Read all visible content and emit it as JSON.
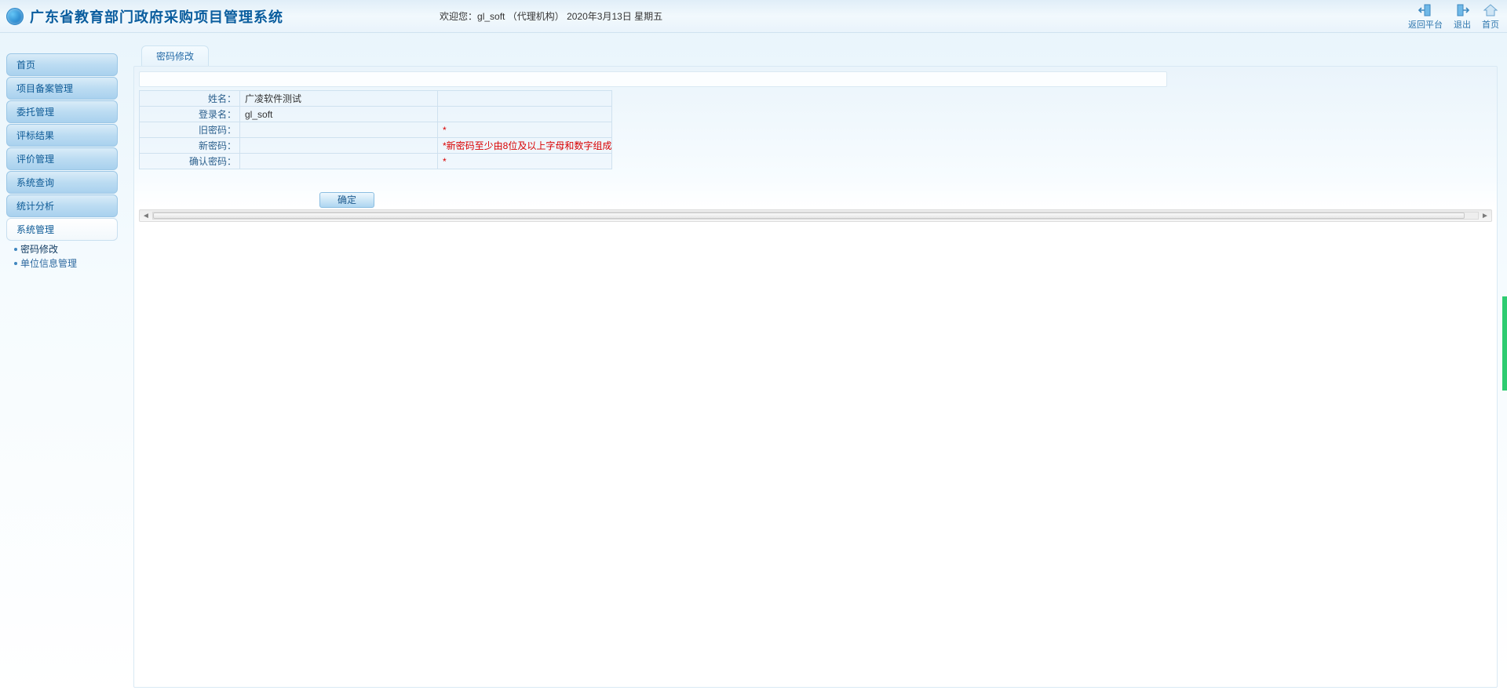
{
  "header": {
    "title": "广东省教育部门政府采购项目管理系统",
    "welcome_prefix": "欢迎您：",
    "user": "gl_soft",
    "role": "（代理机构）",
    "date": "2020年3月13日 星期五",
    "actions": {
      "return": "返回平台",
      "logout": "退出",
      "home": "首页"
    }
  },
  "nav": {
    "items": [
      "首页",
      "项目备案管理",
      "委托管理",
      "评标结果",
      "评价管理",
      "系统查询",
      "统计分析",
      "系统管理"
    ],
    "active_index": 7,
    "sub": [
      "密码修改",
      "单位信息管理"
    ],
    "sub_active_index": 0
  },
  "tab": {
    "label": "密码修改"
  },
  "form": {
    "rows": {
      "name": {
        "label": "姓名：",
        "value": "广凌软件测试",
        "tip": ""
      },
      "login": {
        "label": "登录名：",
        "value": "gl_soft",
        "tip": ""
      },
      "oldpw": {
        "label": "旧密码：",
        "value": "",
        "tip": "*"
      },
      "newpw": {
        "label": "新密码：",
        "value": "",
        "tip": "*新密码至少由8位及以上字母和数字组成"
      },
      "confirm": {
        "label": "确认密码：",
        "value": "",
        "tip": "*"
      }
    },
    "submit": "确定"
  }
}
